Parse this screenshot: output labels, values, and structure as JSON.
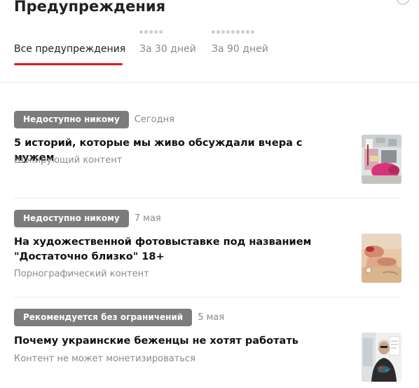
{
  "header": {
    "title": "Предупреждения"
  },
  "tabs": [
    {
      "label": "Все предупреждения",
      "dots": 0,
      "active": true
    },
    {
      "label": "За 30 дней",
      "dots": 5,
      "active": false
    },
    {
      "label": "За 90 дней",
      "dots": 9,
      "active": false
    }
  ],
  "entries": [
    {
      "badge": "Недоступно никому",
      "date": "Сегодня",
      "title": "5 историй, которые мы живо обсуждали вчера с мужем",
      "reason": "Шокирующий контент",
      "thumbnail": "photo-store-shelves-pink"
    },
    {
      "badge": "Недоступно никому",
      "date": "7 мая",
      "title": "На художественной фотовыставке под названием \"Достаточно близко\" 18+",
      "reason": "Порнографический контент",
      "thumbnail": "photo-beach-figure"
    },
    {
      "badge": "Рекомендуется без ограничений",
      "date": "5 мая",
      "title": "Почему украинские беженцы не хотят работать",
      "reason": "Контент не может монетизироваться",
      "thumbnail": "photo-woman-portrait"
    }
  ],
  "colors": {
    "accent": "#e31b1b",
    "badge_bg": "#7c7c7c",
    "muted_text": "#8a8a8a"
  }
}
